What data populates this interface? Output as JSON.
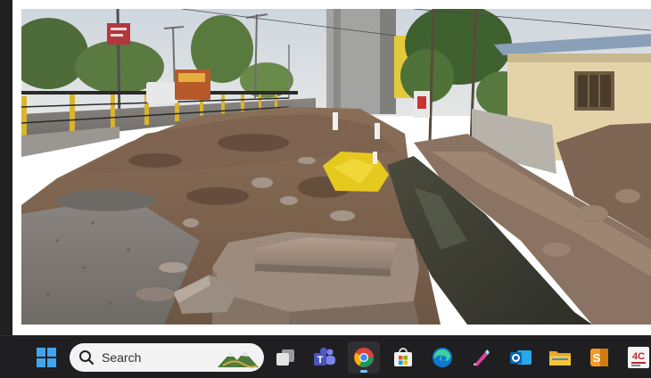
{
  "photo": {
    "sign_text": ""
  },
  "taskbar": {
    "search": {
      "placeholder": "Search"
    },
    "pinned": [
      {
        "icon": "windows-start-icon"
      },
      {
        "icon": "task-view-icon"
      },
      {
        "icon": "teams-icon"
      },
      {
        "icon": "chrome-icon",
        "active": true
      },
      {
        "icon": "microsoft-store-icon"
      },
      {
        "icon": "edge-icon"
      },
      {
        "icon": "paint-pen-icon"
      },
      {
        "icon": "outlook-icon"
      },
      {
        "icon": "file-explorer-icon"
      },
      {
        "icon": "sway-icon"
      },
      {
        "icon": "app-4c-icon",
        "label": "4C"
      }
    ],
    "colors": {
      "background": "#1f1f22",
      "accent": "#7dc5ff"
    }
  }
}
